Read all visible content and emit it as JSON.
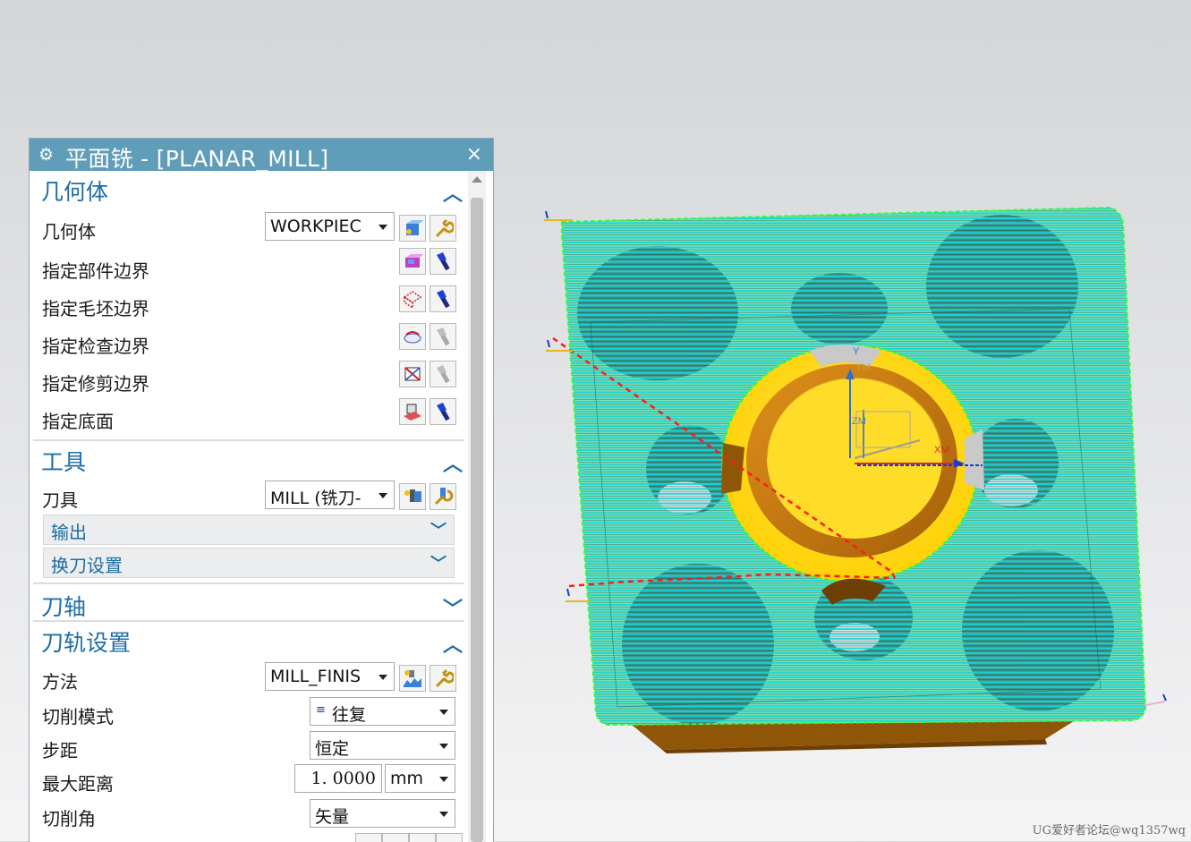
{
  "dialog": {
    "title": "平面铣 - [PLANAR_MILL]",
    "gear_icon": "gear-icon",
    "close_label": "×"
  },
  "geometry": {
    "section_title": "几何体",
    "geometry_label": "几何体",
    "geometry_value": "WORKPIEC",
    "specify_part_boundary": "指定部件边界",
    "specify_blank_boundary": "指定毛坯边界",
    "specify_check_boundary": "指定检查边界",
    "specify_trim_boundary": "指定修剪边界",
    "specify_floor": "指定底面"
  },
  "tool": {
    "section_title": "工具",
    "tool_label": "刀具",
    "tool_value": "MILL (铣刀-",
    "output_label": "输出",
    "tool_change_label": "换刀设置"
  },
  "tool_axis": {
    "section_title": "刀轴"
  },
  "path_settings": {
    "section_title": "刀轨设置",
    "method_label": "方法",
    "method_value": "MILL_FINIS",
    "cut_pattern_label": "切削模式",
    "cut_pattern_value": "往复",
    "stepover_label": "步距",
    "stepover_value": "恒定",
    "max_distance_label": "最大距离",
    "max_distance_value": "1. 0000",
    "max_distance_unit": "mm",
    "cut_angle_label": "切削角",
    "cut_angle_value": "矢量"
  },
  "viewport": {
    "axis_y": "Y",
    "axis_ym": "YM",
    "axis_zm": "ZM",
    "axis_xm": "XM",
    "watermark": "UG爱好者论坛@wq1357wq"
  },
  "colors": {
    "titlebar": "#5f9db9",
    "section_text": "#1e6ea5",
    "toolpath": "#16d8d8",
    "part_yellow": "#ffd820",
    "part_brown": "#b8720f",
    "engage_red": "#ff1a1a"
  }
}
